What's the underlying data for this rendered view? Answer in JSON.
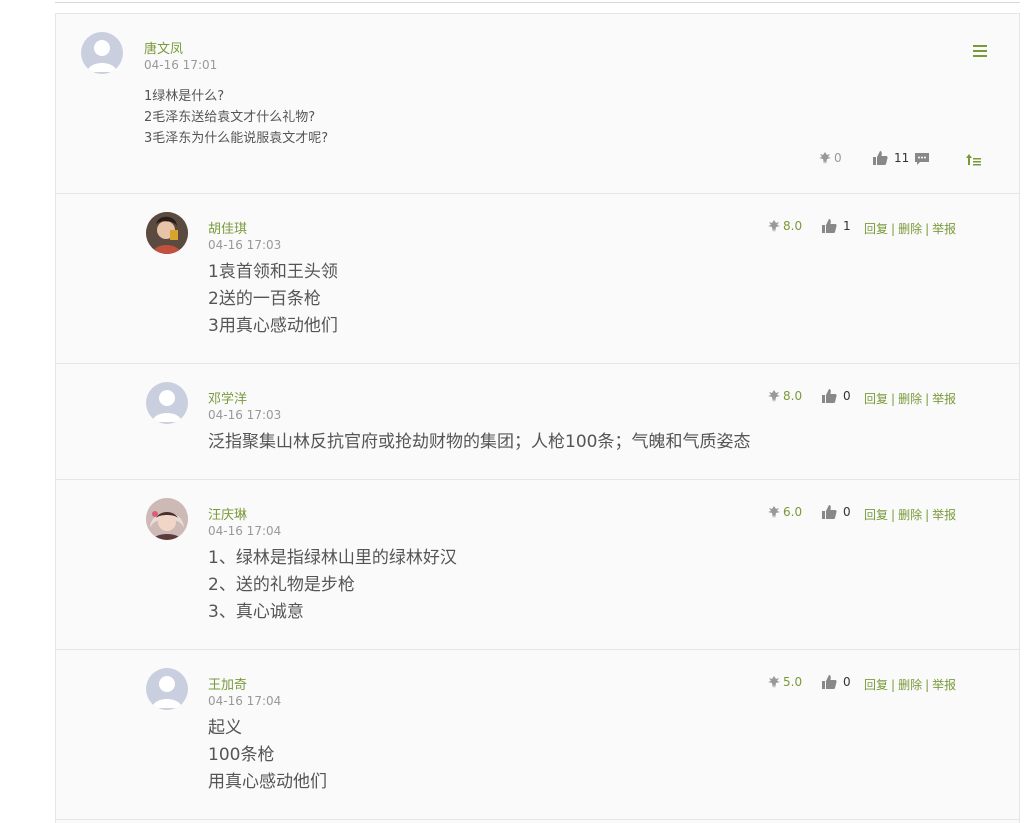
{
  "post": {
    "author": "唐文凤",
    "time": "04-16 17:01",
    "lines": [
      "1绿林是什么?",
      "2毛泽东送给袁文才什么礼物?",
      "3毛泽东为什么能说服袁文才呢?"
    ],
    "rating": "0",
    "likes": "11"
  },
  "reply_actions": {
    "reply": "回复",
    "delete": "删除",
    "report": "举报",
    "sep": "|"
  },
  "replies": [
    {
      "author": "胡佳琪",
      "time": "04-16 17:03",
      "rating": "8.0",
      "likes": "1",
      "lines": [
        "1袁首领和王头领",
        "2送的一百条枪",
        "3用真心感动他们"
      ]
    },
    {
      "author": "邓学洋",
      "time": "04-16 17:03",
      "rating": "8.0",
      "likes": "0",
      "lines": [
        "泛指聚集山林反抗官府或抢劫财物的集团；人枪100条；气魄和气质姿态"
      ]
    },
    {
      "author": "汪庆琳",
      "time": "04-16 17:04",
      "rating": "6.0",
      "likes": "0",
      "lines": [
        "1、绿林是指绿林山里的绿林好汉",
        "2、送的礼物是步枪",
        "3、真心诚意"
      ]
    },
    {
      "author": "王加奇",
      "time": "04-16 17:04",
      "rating": "5.0",
      "likes": "0",
      "lines": [
        "起义",
        "100条枪",
        "用真心感动他们"
      ]
    }
  ],
  "icons": {
    "flower": "flower-icon",
    "thumb": "thumbs-up-icon",
    "comment": "comment-icon",
    "top": "scroll-top-icon",
    "menu": "menu-icon"
  },
  "colors": {
    "accent": "#7a9a3a",
    "text": "#555555",
    "muted": "#999999",
    "avatar": "#c9cfdf"
  }
}
